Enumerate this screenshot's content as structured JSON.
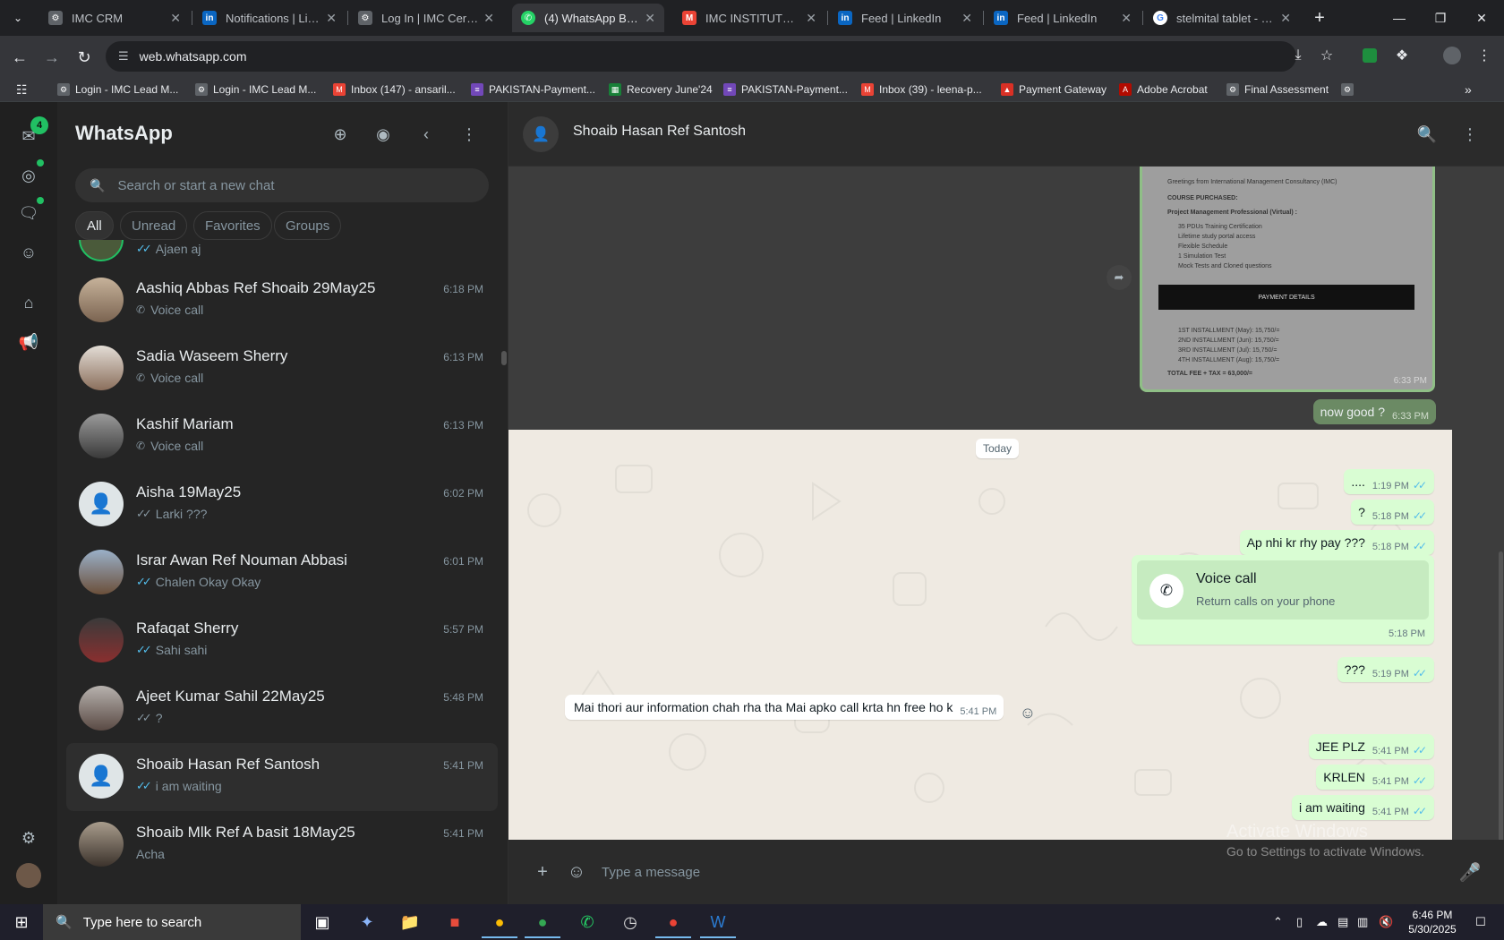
{
  "browser": {
    "tabs": [
      {
        "title": "IMC CRM",
        "icon": "imc-icon",
        "color": "#9aa0a6"
      },
      {
        "title": "Notifications | Linke",
        "icon": "linkedin-icon",
        "color": "#0a66c2"
      },
      {
        "title": "Log In | IMC Certific",
        "icon": "imc-icon",
        "color": "#9aa0a6"
      },
      {
        "title": "(4) WhatsApp Busin",
        "icon": "whatsapp-icon",
        "color": "#25d366"
      },
      {
        "title": "IMC INSTITUTE | EN",
        "icon": "gmail-icon",
        "color": "#ea4335"
      },
      {
        "title": "Feed | LinkedIn",
        "icon": "linkedin-icon",
        "color": "#0a66c2"
      },
      {
        "title": "Feed | LinkedIn",
        "icon": "linkedin-icon",
        "color": "#0a66c2"
      },
      {
        "title": "stelmital tablet - Gc",
        "icon": "google-icon",
        "color": "#4285f4"
      }
    ],
    "active_tab_index": 3,
    "url": "web.whatsapp.com",
    "bookmarks": [
      "Login - IMC Lead M...",
      "Login - IMC Lead M...",
      "Inbox (147) - ansaril...",
      "PAKISTAN-Payment...",
      "Recovery June'24",
      "PAKISTAN-Payment...",
      "Inbox (39) - leena-p...",
      "Payment Gateway",
      "Adobe Acrobat",
      "Final Assessment"
    ]
  },
  "rail": {
    "badge_count": "4"
  },
  "sidebar": {
    "title": "WhatsApp",
    "search_placeholder": "Search or start a new chat",
    "filters": [
      "All",
      "Unread",
      "Favorites",
      "Groups"
    ],
    "partial_top_preview": "Ajaen aj",
    "chats": [
      {
        "name": "Aashiq Abbas Ref Shoaib 29May25",
        "time": "6:18 PM",
        "preview": "Voice call",
        "kind": "call"
      },
      {
        "name": "Sadia Waseem Sherry",
        "time": "6:13 PM",
        "preview": "Voice call",
        "kind": "call"
      },
      {
        "name": "Kashif Mariam",
        "time": "6:13 PM",
        "preview": "Voice call",
        "kind": "call"
      },
      {
        "name": "Aisha 19May25",
        "time": "6:02 PM",
        "preview": "Larki ???",
        "kind": "grey-tick"
      },
      {
        "name": "Israr Awan Ref Nouman Abbasi",
        "time": "6:01 PM",
        "preview": "Chalen Okay Okay",
        "kind": "blue-tick"
      },
      {
        "name": "Rafaqat Sherry",
        "time": "5:57 PM",
        "preview": "Sahi sahi",
        "kind": "blue-tick"
      },
      {
        "name": "Ajeet Kumar Sahil 22May25",
        "time": "5:48 PM",
        "preview": "?",
        "kind": "grey-tick"
      },
      {
        "name": "Shoaib Hasan Ref Santosh",
        "time": "5:41 PM",
        "preview": "i am waiting",
        "kind": "blue-tick"
      },
      {
        "name": "Shoaib Mlk Ref A basit 18May25",
        "time": "5:41 PM",
        "preview": "Acha",
        "kind": "none"
      }
    ]
  },
  "conversation": {
    "contact_name": "Shoaib Hasan Ref Santosh",
    "doc": {
      "lines_top": [
        "Greetings from International Management Consultancy (IMC)",
        "COURSE PURCHASED:",
        "Project Management Professional (Virtual) :"
      ],
      "bullets": [
        "35 PDUs Training Certification",
        "Lifetime study portal access",
        "Flexible Schedule",
        "1 Simulation Test",
        "Mock Tests and Cloned questions"
      ],
      "bar_label": "PAYMENT DETAILS",
      "installments": [
        "1ST  INSTALLMENT (May): 15,750/=",
        "2ND  INSTALLMENT (Jun): 15,750/=",
        "3RD  INSTALLMENT (Jul): 15,750/=",
        "4TH  INSTALLMENT (Aug): 15,750/="
      ],
      "total": "TOTAL FEE + TAX  = 63,000/=",
      "time": "6:33 PM"
    },
    "dim_message": {
      "text": "now good ?",
      "time": "6:33 PM"
    },
    "date_divider": "Today",
    "messages": [
      {
        "dir": "out",
        "text": "....",
        "time": "1:19 PM"
      },
      {
        "dir": "out",
        "text": "?",
        "time": "5:18 PM"
      },
      {
        "dir": "out",
        "text": "Ap nhi kr rhy pay ???",
        "time": "5:18 PM"
      },
      {
        "dir": "out",
        "text": "???",
        "time": "5:19 PM"
      },
      {
        "dir": "in",
        "text": "Mai thori aur information chah rha tha Mai apko call krta hn free ho k",
        "time": "5:41 PM"
      },
      {
        "dir": "out",
        "text": "JEE PLZ",
        "time": "5:41 PM"
      },
      {
        "dir": "out",
        "text": "KRLEN",
        "time": "5:41 PM"
      },
      {
        "dir": "out",
        "text": "i am waiting",
        "time": "5:41 PM"
      }
    ],
    "call_card": {
      "title": "Voice call",
      "subtitle": "Return calls on your phone",
      "time": "5:18 PM"
    },
    "composer_placeholder": "Type a message"
  },
  "watermark": {
    "line1": "Activate Windows",
    "line2": "Go to Settings to activate Windows."
  },
  "taskbar": {
    "search_text": "Type here to search",
    "time": "6:46 PM",
    "date": "5/30/2025"
  }
}
